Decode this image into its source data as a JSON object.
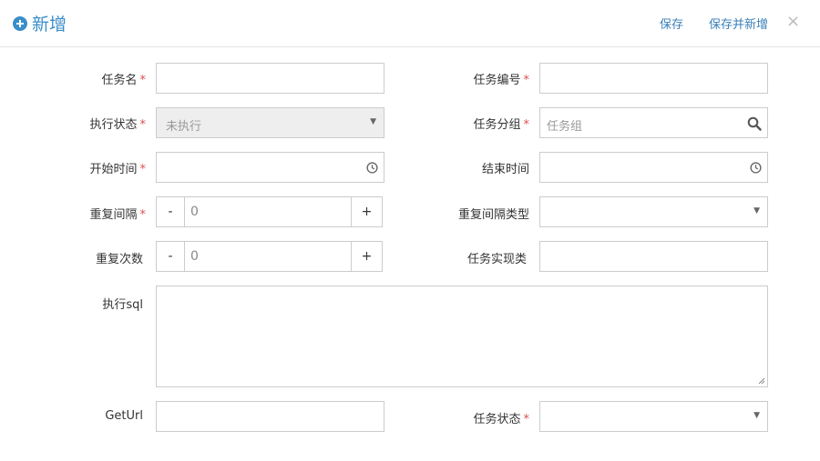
{
  "header": {
    "title": "新增",
    "save_label": "保存",
    "save_new_label": "保存并新增",
    "close_symbol": "×"
  },
  "form": {
    "task_name": {
      "label": "任务名",
      "required": "*",
      "value": ""
    },
    "task_code": {
      "label": "任务编号",
      "required": "*",
      "value": ""
    },
    "exec_status": {
      "label": "执行状态",
      "required": "*",
      "value": "未执行"
    },
    "task_group": {
      "label": "任务分组",
      "required": "*",
      "placeholder": "任务组"
    },
    "start_time": {
      "label": "开始时间",
      "required": "*",
      "value": ""
    },
    "end_time": {
      "label": "结束时间",
      "value": ""
    },
    "repeat_interval": {
      "label": "重复间隔",
      "required": "*",
      "value": "0",
      "minus": "-",
      "plus": "+"
    },
    "repeat_interval_type": {
      "label": "重复间隔类型",
      "value": ""
    },
    "repeat_count": {
      "label": "重复次数",
      "value": "0",
      "minus": "-",
      "plus": "+"
    },
    "task_impl_class": {
      "label": "任务实现类",
      "value": ""
    },
    "exec_sql": {
      "label": "执行sql",
      "value": ""
    },
    "get_url": {
      "label": "GetUrl",
      "value": ""
    },
    "task_status": {
      "label": "任务状态",
      "required": "*",
      "value": ""
    }
  },
  "colors": {
    "accent": "#3a8ec9",
    "required": "#d9534f",
    "border": "#cccccc",
    "disabled_bg": "#eeeeee"
  },
  "icons": [
    "plus-circle-icon",
    "close-icon",
    "caret-down-icon",
    "search-icon",
    "clock-icon",
    "resize-grip-icon"
  ]
}
